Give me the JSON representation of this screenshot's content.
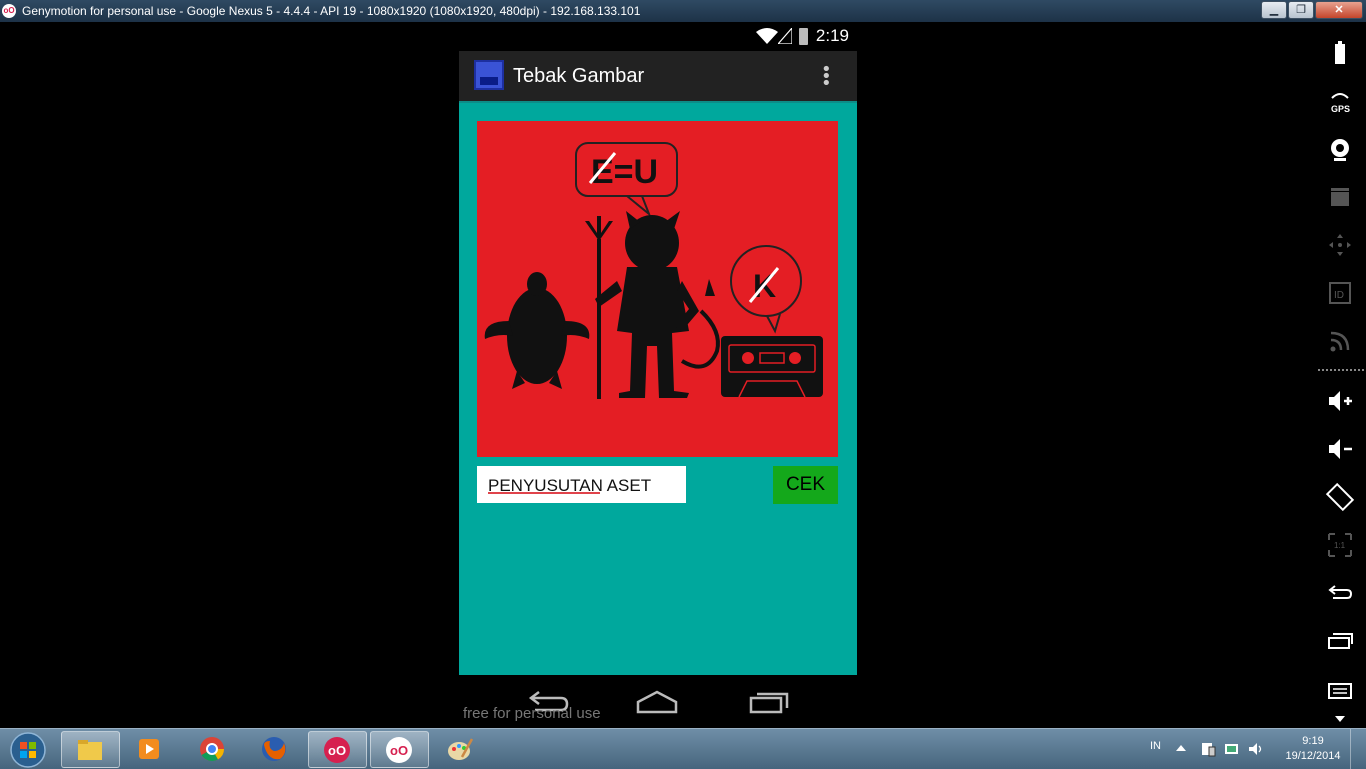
{
  "window": {
    "title": "Genymotion for personal use - Google Nexus 5 - 4.4.4 - API 19 - 1080x1920 (1080x1920, 480dpi) - 192.168.133.101",
    "buttons": [
      "minimize",
      "restore",
      "close"
    ]
  },
  "statusbar": {
    "time": "2:19",
    "icons": [
      "wifi-icon",
      "signal-icon",
      "battery-charging-icon"
    ]
  },
  "actionbar": {
    "title": "Tebak Gambar",
    "overflow_icon": "overflow-menu-icon"
  },
  "puzzle": {
    "bubble_left": "E=U",
    "bubble_right": "K",
    "objects": [
      "turtle",
      "devil",
      "cassette"
    ],
    "background": "#e41e24"
  },
  "answer": {
    "value": "PENYUSUTAN ASET",
    "button_label": "CEK"
  },
  "colors": {
    "content_bg": "#00a89d",
    "button_bg": "#14a81b",
    "actionbar_bg": "#222222"
  },
  "navbar": {
    "buttons": [
      "back-icon",
      "home-icon",
      "recent-apps-icon"
    ]
  },
  "watermark": "free for personal use",
  "sidebar": {
    "items": [
      "battery-icon",
      "gps-icon",
      "webcam-icon",
      "capture-icon",
      "dpad-icon",
      "device-id-icon",
      "network-icon",
      "volume-up-icon",
      "volume-down-icon",
      "rotate-icon",
      "pixel-perfect-icon",
      "back-icon",
      "recent-apps-icon",
      "menu-icon"
    ]
  },
  "taskbar": {
    "apps": [
      "windows-explorer",
      "media-player",
      "chrome",
      "firefox",
      "genymotion",
      "genymotion-device",
      "paint"
    ],
    "language": "IN",
    "time": "9:19",
    "date": "19/12/2014"
  }
}
